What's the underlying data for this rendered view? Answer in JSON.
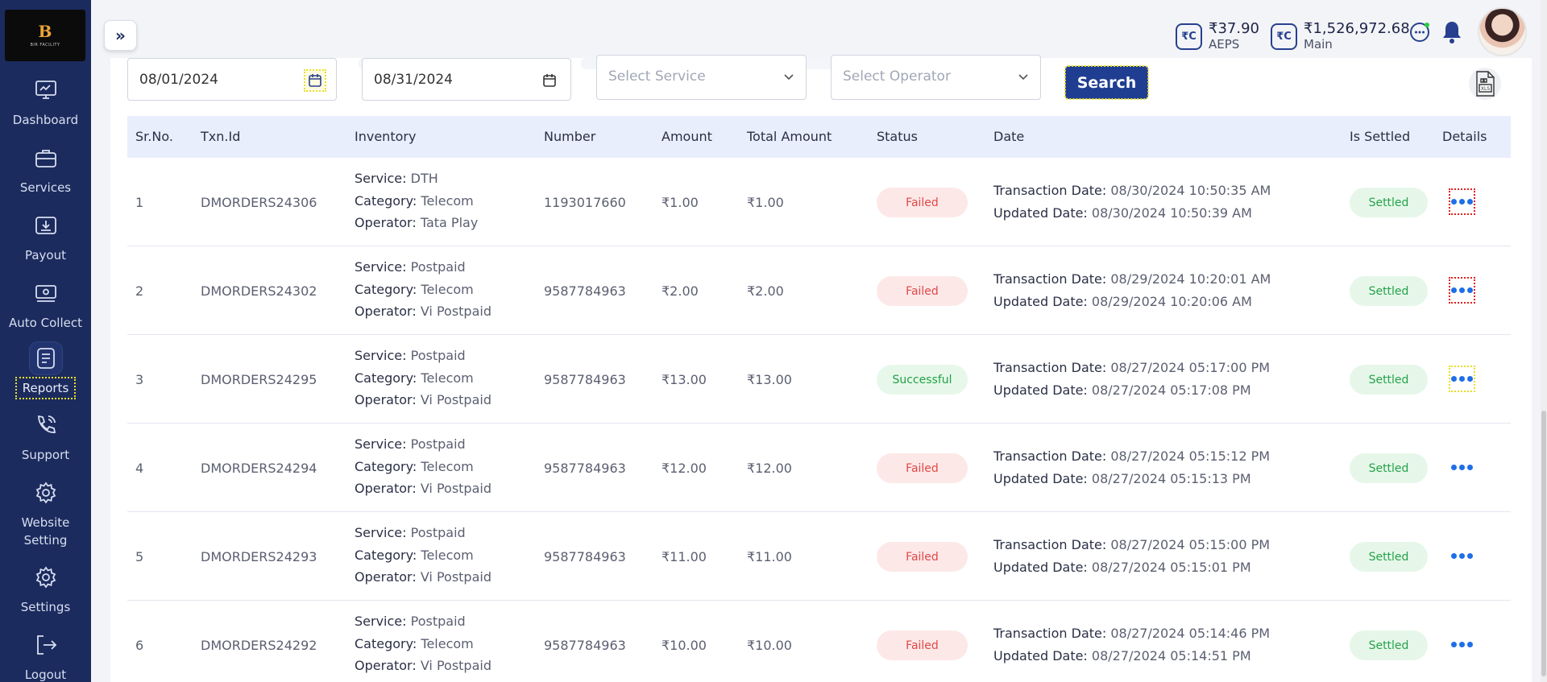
{
  "logo": {
    "mark": "B",
    "text": "BIR FACILITY"
  },
  "sidebar": {
    "items": [
      {
        "label": "Dashboard",
        "icon": "dashboard-icon"
      },
      {
        "label": "Services",
        "icon": "briefcase-icon"
      },
      {
        "label": "Payout",
        "icon": "payout-icon"
      },
      {
        "label": "Auto Collect",
        "icon": "auto-collect-icon"
      },
      {
        "label": "Reports",
        "icon": "reports-icon",
        "active": true
      },
      {
        "label": "Support",
        "icon": "phone-icon"
      },
      {
        "label": "Website Setting",
        "icon": "gear-icon"
      },
      {
        "label": "Settings",
        "icon": "gear-icon"
      },
      {
        "label": "Logout",
        "icon": "logout-icon"
      }
    ]
  },
  "header": {
    "wallets": [
      {
        "amount": "₹37.90",
        "label": "AEPS"
      },
      {
        "amount": "₹1,526,972.68",
        "label": "Main"
      }
    ]
  },
  "filters": {
    "from_date": "08/01/2024",
    "to_date": "08/31/2024",
    "service_placeholder": "Select Service",
    "operator_placeholder": "Select Operator",
    "search_label": "Search"
  },
  "table": {
    "headers": [
      "Sr.No.",
      "Txn.Id",
      "Inventory",
      "Number",
      "Amount",
      "Total Amount",
      "Status",
      "Date",
      "Is Settled",
      "Details"
    ],
    "labels": {
      "service": "Service:",
      "category": "Category:",
      "operator": "Operator:",
      "transaction_date": "Transaction Date:",
      "updated_date": "Updated Date:"
    },
    "rows": [
      {
        "sr": "1",
        "txn": "DMORDERS24306",
        "service": "DTH",
        "category": "Telecom",
        "operator": "Tata Play",
        "number": "1193017660",
        "amount": "₹1.00",
        "total": "₹1.00",
        "status": "Failed",
        "txn_date": "08/30/2024 10:50:35 AM",
        "upd_date": "08/30/2024 10:50:39 AM",
        "settled": "Settled"
      },
      {
        "sr": "2",
        "txn": "DMORDERS24302",
        "service": "Postpaid",
        "category": "Telecom",
        "operator": "Vi Postpaid",
        "number": "9587784963",
        "amount": "₹2.00",
        "total": "₹2.00",
        "status": "Failed",
        "txn_date": "08/29/2024 10:20:01 AM",
        "upd_date": "08/29/2024 10:20:06 AM",
        "settled": "Settled"
      },
      {
        "sr": "3",
        "txn": "DMORDERS24295",
        "service": "Postpaid",
        "category": "Telecom",
        "operator": "Vi Postpaid",
        "number": "9587784963",
        "amount": "₹13.00",
        "total": "₹13.00",
        "status": "Successful",
        "txn_date": "08/27/2024 05:17:00 PM",
        "upd_date": "08/27/2024 05:17:08 PM",
        "settled": "Settled"
      },
      {
        "sr": "4",
        "txn": "DMORDERS24294",
        "service": "Postpaid",
        "category": "Telecom",
        "operator": "Vi Postpaid",
        "number": "9587784963",
        "amount": "₹12.00",
        "total": "₹12.00",
        "status": "Failed",
        "txn_date": "08/27/2024 05:15:12 PM",
        "upd_date": "08/27/2024 05:15:13 PM",
        "settled": "Settled"
      },
      {
        "sr": "5",
        "txn": "DMORDERS24293",
        "service": "Postpaid",
        "category": "Telecom",
        "operator": "Vi Postpaid",
        "number": "9587784963",
        "amount": "₹11.00",
        "total": "₹11.00",
        "status": "Failed",
        "txn_date": "08/27/2024 05:15:00 PM",
        "upd_date": "08/27/2024 05:15:01 PM",
        "settled": "Settled"
      },
      {
        "sr": "6",
        "txn": "DMORDERS24292",
        "service": "Postpaid",
        "category": "Telecom",
        "operator": "Vi Postpaid",
        "number": "9587784963",
        "amount": "₹10.00",
        "total": "₹10.00",
        "status": "Failed",
        "txn_date": "08/27/2024 05:14:46 PM",
        "upd_date": "08/27/2024 05:14:51 PM",
        "settled": "Settled"
      }
    ]
  },
  "colors": {
    "sidebar": "#1c2b5e",
    "accent": "#203e91",
    "failed": "#e04848",
    "success": "#22a046",
    "details": "#1e6ee8"
  }
}
